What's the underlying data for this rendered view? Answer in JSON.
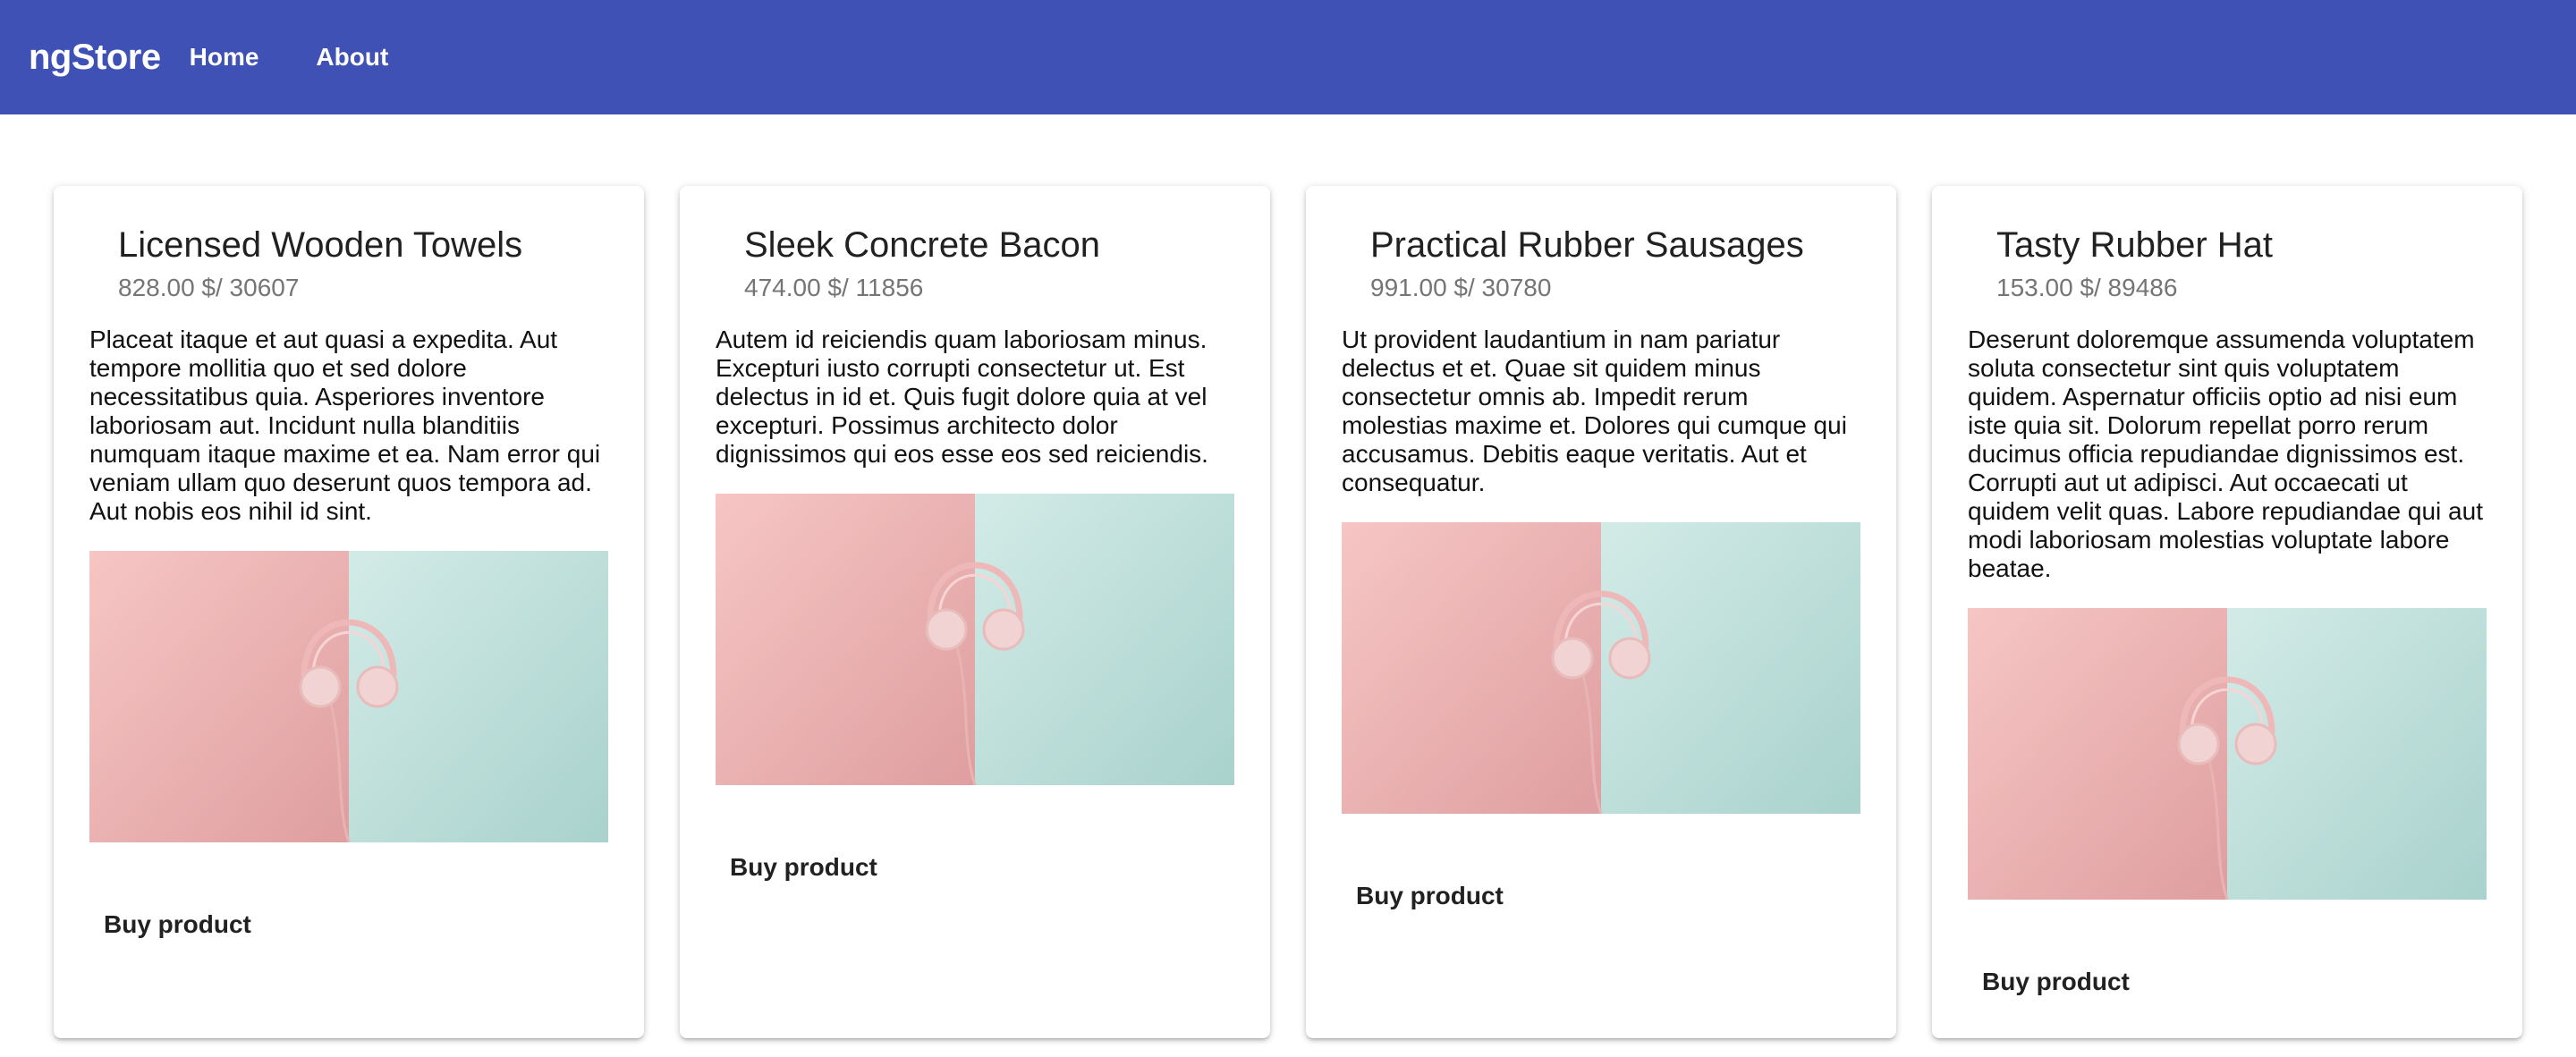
{
  "app": {
    "brand": "ngStore",
    "nav": [
      {
        "label": "Home"
      },
      {
        "label": "About"
      }
    ]
  },
  "products": [
    {
      "title": "Licensed Wooden Towels",
      "subtitle": "828.00 $/ 30607",
      "description": "Placeat itaque et aut quasi a expedita. Aut tempore mollitia quo et sed dolore necessitatibus quia. Asperiores inventore laboriosam aut. Incidunt nulla blanditiis numquam itaque maxime et ea. Nam error qui veniam ullam quo deserunt quos tempora ad. Aut nobis eos nihil id sint.",
      "button": "Buy product"
    },
    {
      "title": "Sleek Concrete Bacon",
      "subtitle": "474.00 $/ 11856",
      "description": "Autem id reiciendis quam laboriosam minus. Excepturi iusto corrupti consectetur ut. Est delectus in id et. Quis fugit dolore quia at vel excepturi. Possimus architecto dolor dignissimos qui eos esse eos sed reiciendis.",
      "button": "Buy product"
    },
    {
      "title": "Practical Rubber Sausages",
      "subtitle": "991.00 $/ 30780",
      "description": "Ut provident laudantium in nam pariatur delectus et et. Quae sit quidem minus consectetur omnis ab. Impedit rerum molestias maxime et. Dolores qui cumque qui accusamus. Debitis eaque veritatis. Aut et consequatur.",
      "button": "Buy product"
    },
    {
      "title": "Tasty Rubber Hat",
      "subtitle": "153.00 $/ 89486",
      "description": "Deserunt doloremque assumenda voluptatem soluta consectetur sint quis voluptatem quidem. Aspernatur officiis optio ad nisi eum iste quia sit. Dolorum repellat porro rerum ducimus officia repudiandae dignissimos est. Corrupti aut ut adipisci. Aut occaecati ut quidem velit quas. Labore repudiandae qui aut modi laboriosam molestias voluptate labore beatae.",
      "button": "Buy product"
    }
  ],
  "colors": {
    "toolbar": "#3f51b5",
    "image_left": "#f2b8b8",
    "image_right": "#c5e3df",
    "headphones": "#f0c9c9"
  },
  "icons": [
    "headphones-image"
  ]
}
